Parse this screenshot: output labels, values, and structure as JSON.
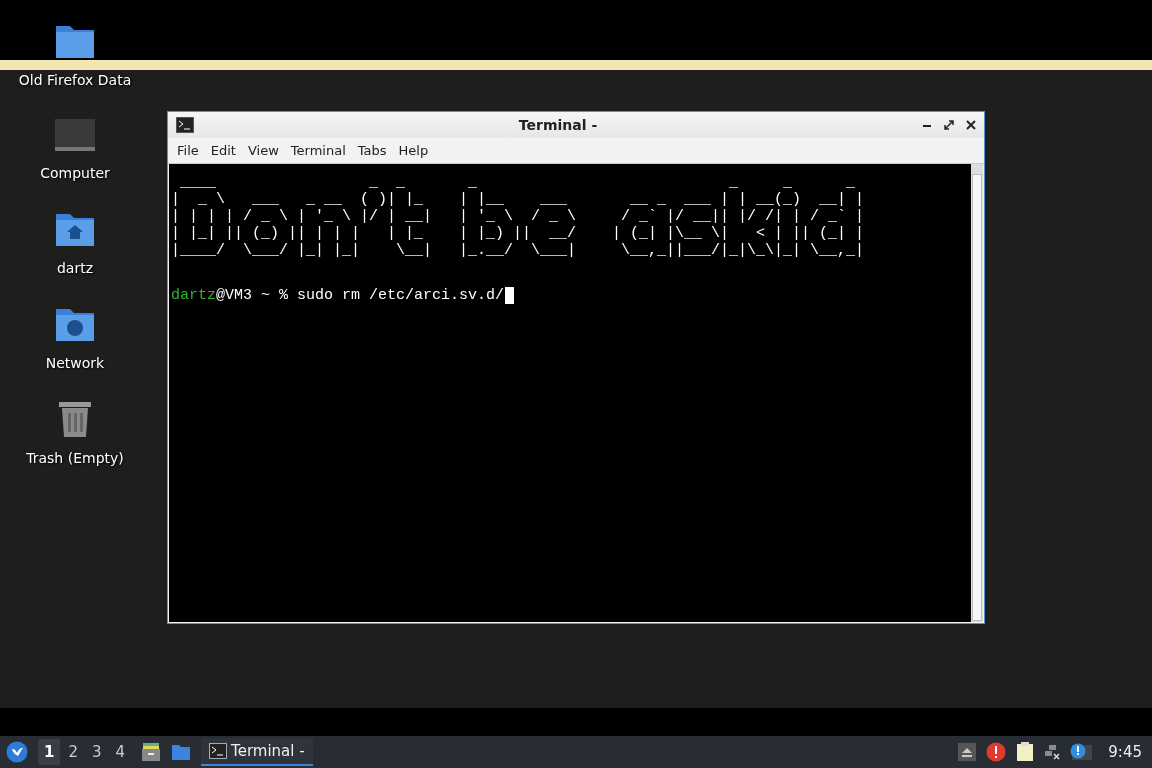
{
  "desktop_icons": [
    {
      "label": "Old Firefox Data",
      "kind": "folder"
    },
    {
      "label": "Computer",
      "kind": "computer"
    },
    {
      "label": "dartz",
      "kind": "home"
    },
    {
      "label": "Network",
      "kind": "network"
    },
    {
      "label": "Trash (Empty)",
      "kind": "trash"
    }
  ],
  "terminal": {
    "title": "Terminal -",
    "menu": [
      "File",
      "Edit",
      "View",
      "Terminal",
      "Tabs",
      "Help"
    ],
    "banner": [
      " ____                 _  _       _                            _     _      _",
      "|  _ \\   ___   _ __  ( )| |_    | |__    ___       __ _  ___ | | __(_)  __| |",
      "| | | | / _ \\ | '_ \\ |/ | __|   | '_ \\  / _ \\     / _` |/ __|| |/ /| | / _` |",
      "| |_| || (_) || | | |   | |_    | |_) ||  __/    | (_| |\\__ \\|   < | || (_| |",
      "|____/  \\___/ |_| |_|    \\__|   |_.__/  \\___|     \\__,_||___/|_|\\_\\|_| \\__,_|"
    ],
    "prompt": {
      "user": "dartz",
      "rest": "@VM3 ~ % sudo rm /etc/arci.sv.d/"
    }
  },
  "taskbar": {
    "workspaces": [
      {
        "label": "1",
        "selected": true
      },
      {
        "label": "2",
        "selected": false
      },
      {
        "label": "3",
        "selected": false
      },
      {
        "label": "4",
        "selected": false
      }
    ],
    "tasks": [
      {
        "label": "Terminal -",
        "selected": true
      }
    ],
    "clock": "9:45"
  }
}
